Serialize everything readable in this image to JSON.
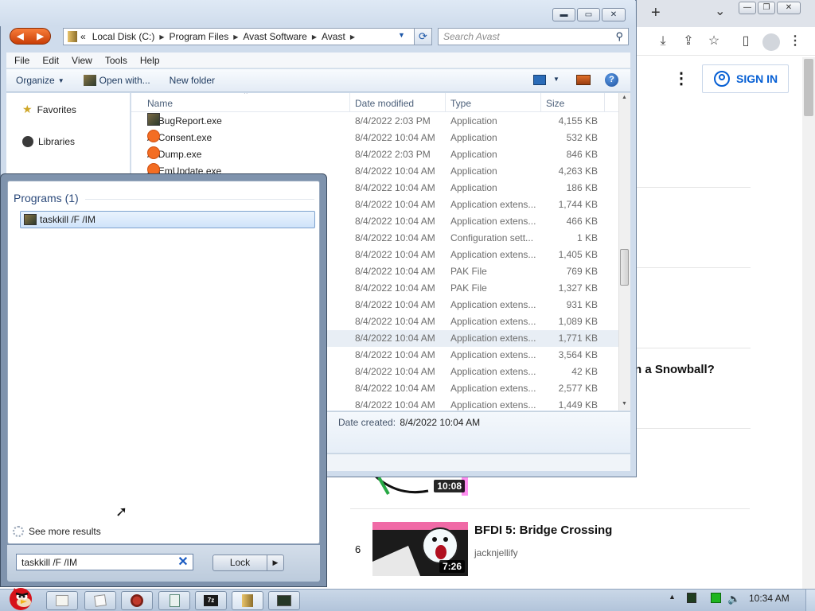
{
  "browser": {
    "tab_new": "+",
    "tab_dropdown": "⌄",
    "sign_in_label": "SIGN IN",
    "partial_title": "n a Snowball?",
    "videos": [
      {
        "rank": "",
        "duration": "10:08"
      },
      {
        "rank": "6",
        "title": "BFDI 5: Bridge Crossing",
        "channel": "jacknjellify",
        "duration": "7:26"
      }
    ]
  },
  "explorer": {
    "breadcrumb": [
      "Local Disk (C:)",
      "Program Files",
      "Avast Software",
      "Avast"
    ],
    "breadcrumb_prefix": "«",
    "search_placeholder": "Search Avast",
    "menu": [
      "File",
      "Edit",
      "View",
      "Tools",
      "Help"
    ],
    "commands": {
      "organize": "Organize",
      "open_with": "Open with...",
      "new_folder": "New folder"
    },
    "nav": {
      "favorites": "Favorites",
      "libraries": "Libraries"
    },
    "columns": {
      "name": "Name",
      "date": "Date modified",
      "type": "Type",
      "size": "Size"
    },
    "files": [
      {
        "name": "AvBugReport.exe",
        "date": "8/4/2022 2:03 PM",
        "type": "Application",
        "size": "4,155 KB",
        "icon": "app"
      },
      {
        "name": "AvConsent.exe",
        "date": "8/4/2022 10:04 AM",
        "type": "Application",
        "size": "532 KB",
        "icon": "avast"
      },
      {
        "name": "AvDump.exe",
        "date": "8/4/2022 2:03 PM",
        "type": "Application",
        "size": "846 KB",
        "icon": "avast"
      },
      {
        "name": "AvEmUpdate.exe",
        "date": "8/4/2022 10:04 AM",
        "type": "Application",
        "size": "4,263 KB",
        "icon": "avast"
      },
      {
        "name": "",
        "date": "8/4/2022 10:04 AM",
        "type": "Application",
        "size": "186 KB"
      },
      {
        "name": "",
        "date": "8/4/2022 10:04 AM",
        "type": "Application extens...",
        "size": "1,744 KB"
      },
      {
        "name": "",
        "date": "8/4/2022 10:04 AM",
        "type": "Application extens...",
        "size": "466 KB"
      },
      {
        "name": "",
        "date": "8/4/2022 10:04 AM",
        "type": "Configuration sett...",
        "size": "1 KB"
      },
      {
        "name": "",
        "date": "8/4/2022 10:04 AM",
        "type": "Application extens...",
        "size": "1,405 KB"
      },
      {
        "name": "",
        "date": "8/4/2022 10:04 AM",
        "type": "PAK File",
        "size": "769 KB"
      },
      {
        "name": "",
        "date": "8/4/2022 10:04 AM",
        "type": "PAK File",
        "size": "1,327 KB"
      },
      {
        "name": "",
        "date": "8/4/2022 10:04 AM",
        "type": "Application extens...",
        "size": "931 KB"
      },
      {
        "name": "",
        "date": "8/4/2022 10:04 AM",
        "type": "Application extens...",
        "size": "1,089 KB"
      },
      {
        "name": "",
        "date": "8/4/2022 10:04 AM",
        "type": "Application extens...",
        "size": "1,771 KB"
      },
      {
        "name": "",
        "date": "8/4/2022 10:04 AM",
        "type": "Application extens...",
        "size": "3,564 KB"
      },
      {
        "name": "",
        "date": "8/4/2022 10:04 AM",
        "type": "Application extens...",
        "size": "42 KB"
      },
      {
        "name": "",
        "date": "8/4/2022 10:04 AM",
        "type": "Application extens...",
        "size": "2,577 KB"
      },
      {
        "name": "",
        "date": "8/4/2022 10:04 AM",
        "type": "Application extens...",
        "size": "1,449 KB"
      }
    ],
    "highlighted_row_index": 13,
    "details": {
      "label": "Date created:",
      "value": "8/4/2022 10:04 AM"
    }
  },
  "startmenu": {
    "programs_heading": "Programs (1)",
    "result_label": "taskkill /F /IM",
    "see_more": "See more results",
    "search_value": "taskkill /F /IM ",
    "power_label": "Lock"
  },
  "taskbar": {
    "clock": "10:34 AM",
    "apps": [
      "files",
      "notepad",
      "steam",
      "document",
      "7zip",
      "explorer",
      "cmd"
    ]
  }
}
